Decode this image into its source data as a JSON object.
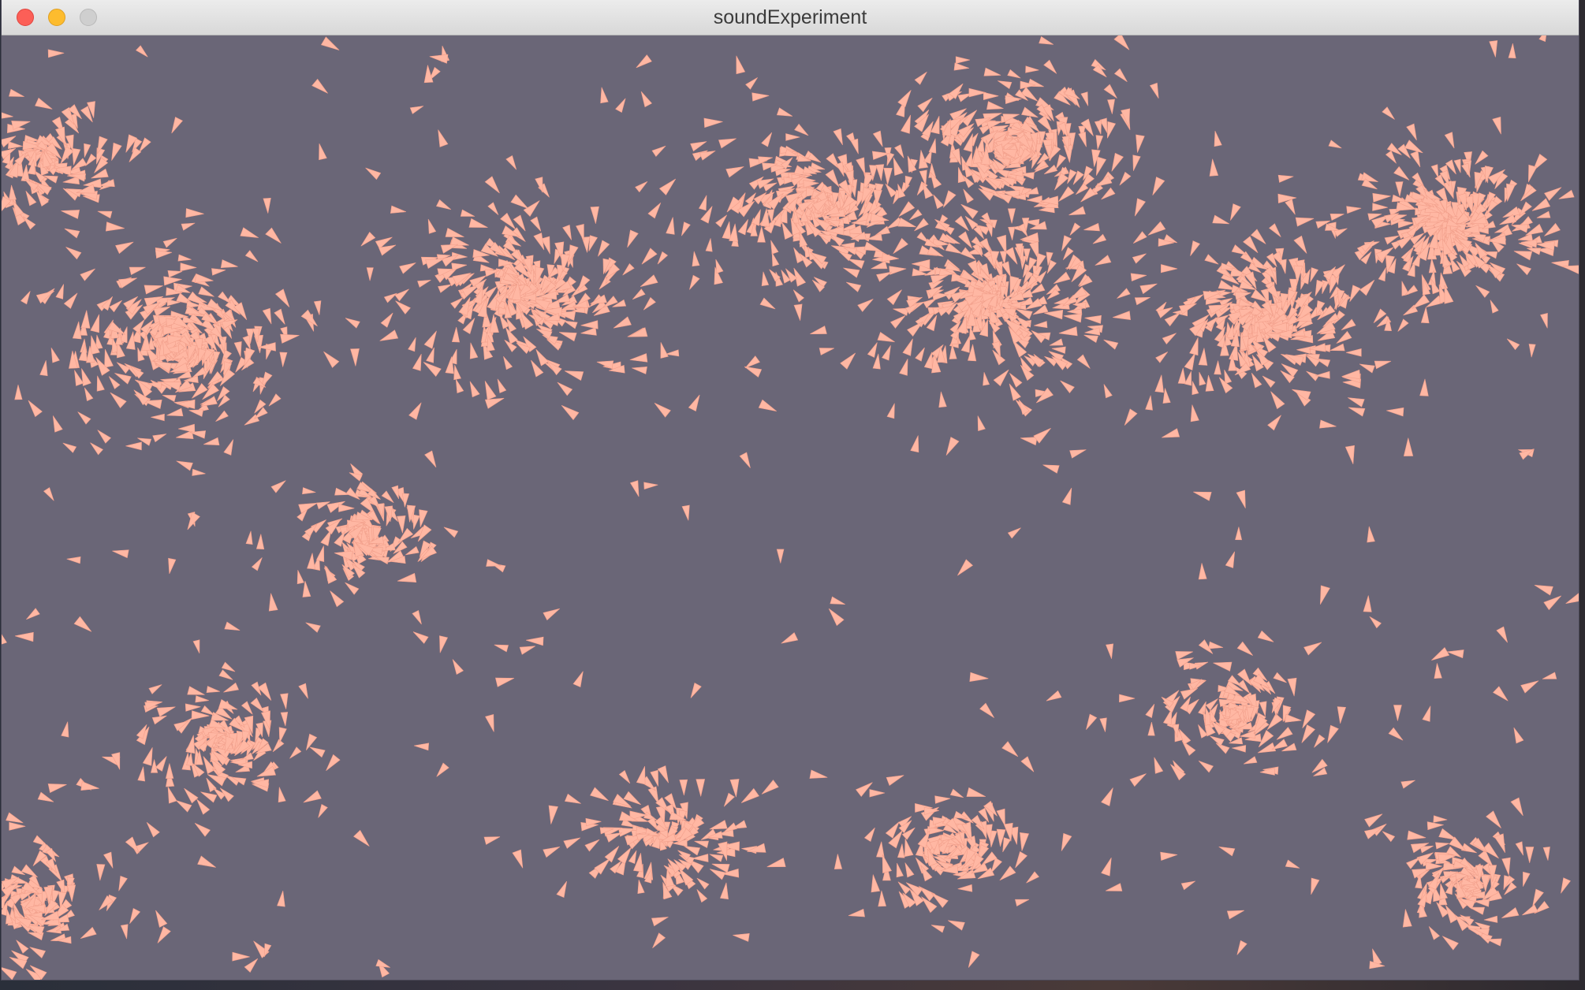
{
  "window": {
    "title": "soundExperiment"
  },
  "controls": {
    "close": "close-button",
    "minimize": "minimize-button",
    "zoom": "zoom-button"
  },
  "colors": {
    "canvas_background": "#6a6677",
    "particle_fill": "#ffb7a3",
    "particle_stroke": "#f2a08c",
    "titlebar": "#e4e4e4"
  },
  "simulation": {
    "particle_shape": "triangle",
    "flock_centers": [
      [
        0.11,
        0.33
      ],
      [
        0.33,
        0.27
      ],
      [
        0.52,
        0.18
      ],
      [
        0.64,
        0.12
      ],
      [
        0.63,
        0.28
      ],
      [
        0.8,
        0.3
      ],
      [
        0.92,
        0.2
      ],
      [
        0.03,
        0.13
      ],
      [
        0.14,
        0.75
      ],
      [
        0.23,
        0.53
      ],
      [
        0.42,
        0.85
      ],
      [
        0.6,
        0.86
      ],
      [
        0.93,
        0.9
      ],
      [
        0.78,
        0.72
      ],
      [
        0.02,
        0.92
      ]
    ]
  }
}
